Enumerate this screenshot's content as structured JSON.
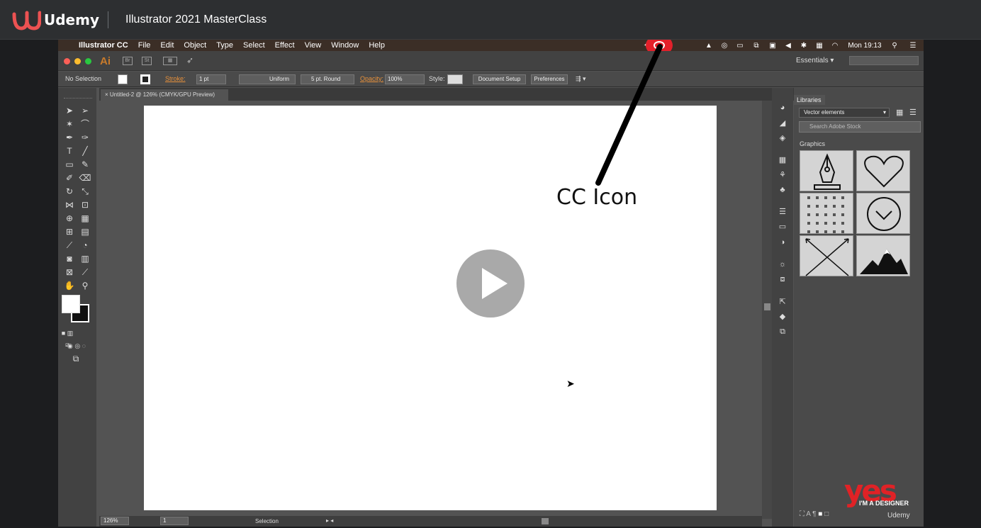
{
  "udemy": {
    "brand": "Udemy",
    "course_title": "Illustrator 2021 MasterClass"
  },
  "menubar": {
    "app": "Illustrator CC",
    "items": [
      "File",
      "Edit",
      "Object",
      "Type",
      "Select",
      "Effect",
      "View",
      "Window",
      "Help"
    ],
    "clock": "Mon 19:13"
  },
  "appbar": {
    "logo": "Ai",
    "bridge": "Br",
    "stock": "St",
    "workspace": "Essentials"
  },
  "control": {
    "selection": "No Selection",
    "stroke_label": "Stroke:",
    "stroke_value": "1 pt",
    "profile": "Uniform",
    "brush": "5 pt. Round",
    "opacity_label": "Opacity:",
    "opacity_value": "100%",
    "style_label": "Style:",
    "document_setup": "Document Setup",
    "preferences": "Preferences"
  },
  "document": {
    "tab_title": "Untitled-2 @ 126% (CMYK/GPU Preview)"
  },
  "status": {
    "zoom": "126%",
    "artboard": "1",
    "tool": "Selection"
  },
  "libraries": {
    "tab": "Libraries",
    "library_name": "Vector elements",
    "search_placeholder": "Search Adobe Stock",
    "section": "Graphics"
  },
  "annotation": {
    "label": "CC Icon",
    "highlight_color": "#e3202a"
  },
  "watermark": {
    "yes": "yes",
    "designer": "I'M A DESIGNER",
    "udemy": "Udemy"
  }
}
